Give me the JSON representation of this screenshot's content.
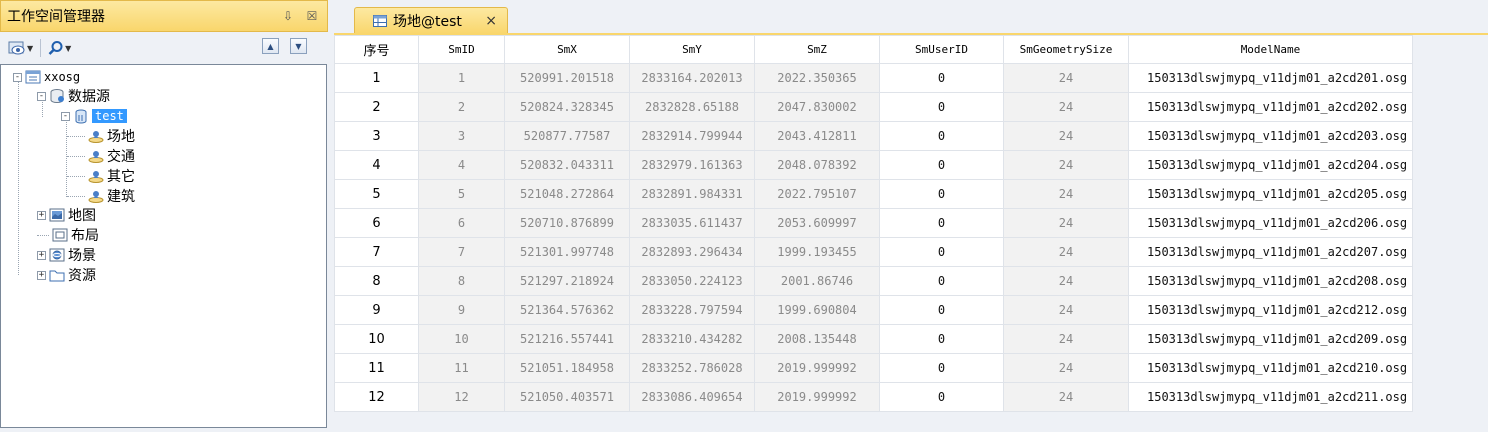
{
  "workspace": {
    "title": "工作空间管理器",
    "pin_glyph": "⇩",
    "close_glyph": "☒",
    "tree": {
      "root": "xxosg",
      "datasources": "数据源",
      "datasource_name": "test",
      "datasets": [
        "场地",
        "交通",
        "其它",
        "建筑"
      ],
      "maps": "地图",
      "layouts": "布局",
      "scenes": "场景",
      "resources": "资源"
    }
  },
  "tab": {
    "label": "场地@test",
    "close": "×"
  },
  "grid": {
    "columns": [
      "序号",
      "SmID",
      "SmX",
      "SmY",
      "SmZ",
      "SmUserID",
      "SmGeometrySize",
      "ModelName"
    ],
    "rows": [
      [
        "1",
        "1",
        "520991.201518",
        "2833164.202013",
        "2022.350365",
        "0",
        "24",
        "150313dlswjmypq_v11djm01_a2cd201.osg"
      ],
      [
        "2",
        "2",
        "520824.328345",
        "2832828.65188",
        "2047.830002",
        "0",
        "24",
        "150313dlswjmypq_v11djm01_a2cd202.osg"
      ],
      [
        "3",
        "3",
        "520877.77587",
        "2832914.799944",
        "2043.412811",
        "0",
        "24",
        "150313dlswjmypq_v11djm01_a2cd203.osg"
      ],
      [
        "4",
        "4",
        "520832.043311",
        "2832979.161363",
        "2048.078392",
        "0",
        "24",
        "150313dlswjmypq_v11djm01_a2cd204.osg"
      ],
      [
        "5",
        "5",
        "521048.272864",
        "2832891.984331",
        "2022.795107",
        "0",
        "24",
        "150313dlswjmypq_v11djm01_a2cd205.osg"
      ],
      [
        "6",
        "6",
        "520710.876899",
        "2833035.611437",
        "2053.609997",
        "0",
        "24",
        "150313dlswjmypq_v11djm01_a2cd206.osg"
      ],
      [
        "7",
        "7",
        "521301.997748",
        "2832893.296434",
        "1999.193455",
        "0",
        "24",
        "150313dlswjmypq_v11djm01_a2cd207.osg"
      ],
      [
        "8",
        "8",
        "521297.218924",
        "2833050.224123",
        "2001.86746",
        "0",
        "24",
        "150313dlswjmypq_v11djm01_a2cd208.osg"
      ],
      [
        "9",
        "9",
        "521364.576362",
        "2833228.797594",
        "1999.690804",
        "0",
        "24",
        "150313dlswjmypq_v11djm01_a2cd212.osg"
      ],
      [
        "10",
        "10",
        "521216.557441",
        "2833210.434282",
        "2008.135448",
        "0",
        "24",
        "150313dlswjmypq_v11djm01_a2cd209.osg"
      ],
      [
        "11",
        "11",
        "521051.184958",
        "2833252.786028",
        "2019.999992",
        "0",
        "24",
        "150313dlswjmypq_v11djm01_a2cd210.osg"
      ],
      [
        "12",
        "12",
        "521050.403571",
        "2833086.409654",
        "2019.999992",
        "0",
        "24",
        "150313dlswjmypq_v11djm01_a2cd211.osg"
      ]
    ]
  },
  "colors": {
    "accent": "#f9d66c",
    "selection": "#3399ff",
    "system_field_bg": "#f2f2f2"
  }
}
